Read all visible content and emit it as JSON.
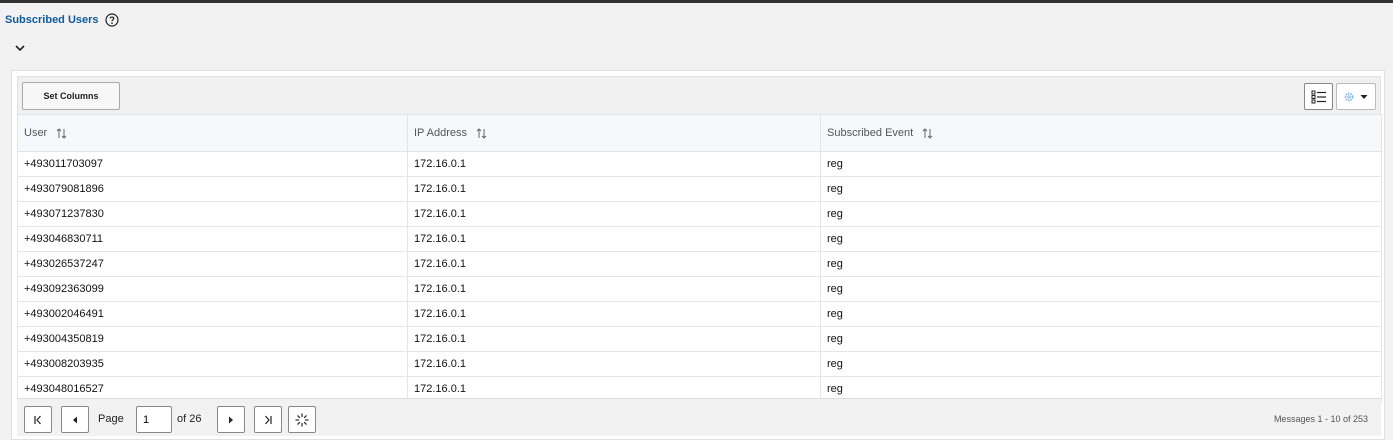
{
  "header": {
    "title": "Subscribed Users",
    "help_icon": "help-circle-icon",
    "collapse_icon": "chevron-down-icon"
  },
  "toolbar": {
    "set_columns_label": "Set Columns",
    "list_view_icon": "list-view-icon",
    "settings_icon": "gear-icon",
    "settings_caret_icon": "caret-down-icon"
  },
  "table": {
    "columns": [
      {
        "label": "User",
        "sort_icon": "sort-icon"
      },
      {
        "label": "IP Address",
        "sort_icon": "sort-icon"
      },
      {
        "label": "Subscribed Event",
        "sort_icon": "sort-icon"
      }
    ],
    "rows": [
      {
        "user": "+493011703097",
        "ip": "172.16.0.1",
        "event": "reg"
      },
      {
        "user": "+493079081896",
        "ip": "172.16.0.1",
        "event": "reg"
      },
      {
        "user": "+493071237830",
        "ip": "172.16.0.1",
        "event": "reg"
      },
      {
        "user": "+493046830711",
        "ip": "172.16.0.1",
        "event": "reg"
      },
      {
        "user": "+493026537247",
        "ip": "172.16.0.1",
        "event": "reg"
      },
      {
        "user": "+493092363099",
        "ip": "172.16.0.1",
        "event": "reg"
      },
      {
        "user": "+493002046491",
        "ip": "172.16.0.1",
        "event": "reg"
      },
      {
        "user": "+493004350819",
        "ip": "172.16.0.1",
        "event": "reg"
      },
      {
        "user": "+493008203935",
        "ip": "172.16.0.1",
        "event": "reg"
      },
      {
        "user": "+493048016527",
        "ip": "172.16.0.1",
        "event": "reg"
      }
    ]
  },
  "pagination": {
    "page_label": "Page",
    "current_page": "1",
    "of_label": "of 26",
    "messages": "Messages 1 - 10 of 253",
    "first_icon": "first-page-icon",
    "prev_icon": "previous-page-icon",
    "next_icon": "next-page-icon",
    "last_icon": "last-page-icon",
    "refresh_icon": "refresh-icon"
  },
  "colors": {
    "title": "#0f5a9c",
    "header_bg": "#f6f9fb",
    "page_bg": "#f2f2f2"
  }
}
